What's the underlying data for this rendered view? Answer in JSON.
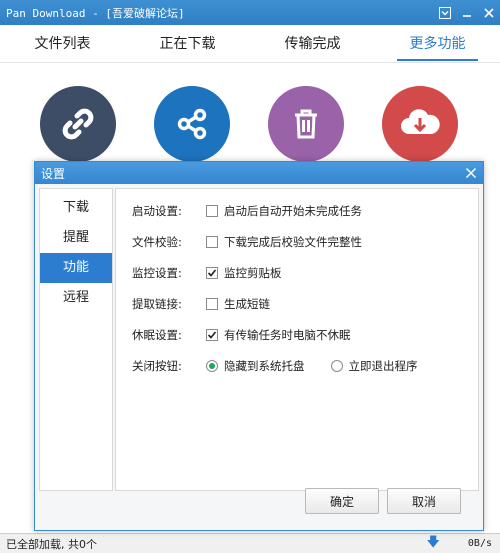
{
  "window": {
    "title": "Pan Download - [吾爱破解论坛]"
  },
  "tabs": [
    {
      "label": "文件列表",
      "active": false
    },
    {
      "label": "正在下载",
      "active": false
    },
    {
      "label": "传输完成",
      "active": false
    },
    {
      "label": "更多功能",
      "active": true
    }
  ],
  "feature_icons": [
    "link-icon",
    "share-icon",
    "trash-icon",
    "cloud-download-icon"
  ],
  "colors": {
    "accent": "#2c7ccf",
    "titlebar": "#2f7fc6",
    "link_circle": "#3d4d66",
    "share_circle": "#1d73bd",
    "trash_circle": "#9a62a8",
    "download_circle": "#d24a4a",
    "radio_selected": "#1aa85a"
  },
  "dialog": {
    "title": "设置",
    "sidebar": [
      {
        "label": "下载",
        "active": false
      },
      {
        "label": "提醒",
        "active": false
      },
      {
        "label": "功能",
        "active": true
      },
      {
        "label": "远程",
        "active": false
      }
    ],
    "settings": [
      {
        "label": "启动设置:",
        "option": "启动后自动开始未完成任务",
        "checked": false
      },
      {
        "label": "文件校验:",
        "option": "下载完成后校验文件完整性",
        "checked": false
      },
      {
        "label": "监控设置:",
        "option": "监控剪贴板",
        "checked": true
      },
      {
        "label": "提取链接:",
        "option": "生成短链",
        "checked": false
      },
      {
        "label": "休眠设置:",
        "option": "有传输任务时电脑不休眠",
        "checked": true
      }
    ],
    "close_button": {
      "label": "关闭按钮:",
      "options": [
        {
          "label": "隐藏到系统托盘",
          "selected": true
        },
        {
          "label": "立即退出程序",
          "selected": false
        }
      ]
    },
    "ok_label": "确定",
    "cancel_label": "取消"
  },
  "status": {
    "text": "已全部加载, 共0个",
    "speed": "0B/s"
  }
}
